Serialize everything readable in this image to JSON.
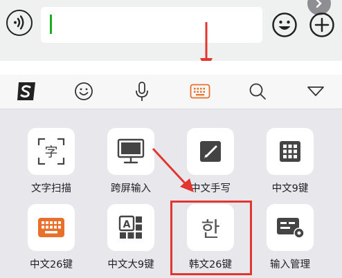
{
  "colors": {
    "accent": "#e8702a",
    "highlight": "#e2352f",
    "cursor": "#1aad19"
  },
  "chatbar": {
    "icons": [
      "voice-icon",
      "emoji-icon",
      "plus-icon"
    ]
  },
  "toolbar": {
    "icons": [
      "sogou-logo-icon",
      "smiley-icon",
      "microphone-icon",
      "keyboard-icon",
      "search-icon",
      "collapse-triangle-icon"
    ]
  },
  "tiles": [
    {
      "label": "文字扫描",
      "icon": "scan-text-icon",
      "glyph": "字"
    },
    {
      "label": "跨屏输入",
      "icon": "monitor-icon"
    },
    {
      "label": "中文手写",
      "icon": "handwriting-pen-icon"
    },
    {
      "label": "中文9键",
      "icon": "nine-grid-icon"
    },
    {
      "label": "中文26键",
      "icon": "keyboard-26-icon"
    },
    {
      "label": "中文大9键",
      "icon": "big-nine-keys-icon",
      "glyph": "A"
    },
    {
      "label": "韩文26键",
      "icon": "korean-char-icon",
      "glyph": "한"
    },
    {
      "label": "输入管理",
      "icon": "input-settings-icon"
    }
  ]
}
